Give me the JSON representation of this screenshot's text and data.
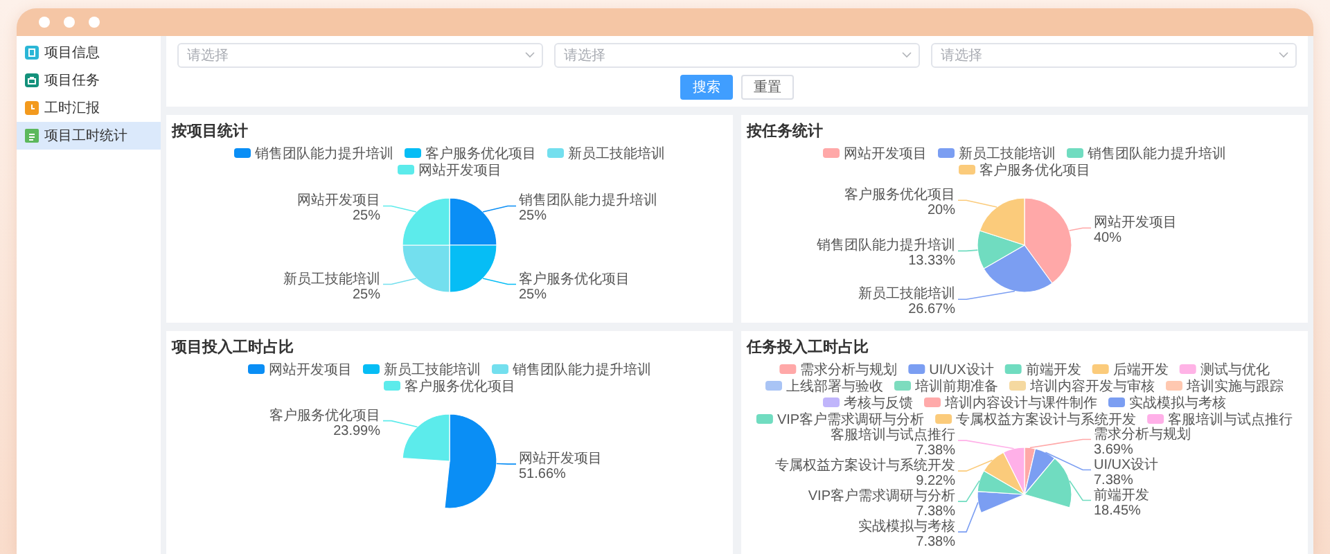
{
  "sidebar": {
    "items": [
      {
        "label": "项目信息",
        "kind": "info",
        "selected": false
      },
      {
        "label": "项目任务",
        "kind": "task",
        "selected": false
      },
      {
        "label": "工时汇报",
        "kind": "report",
        "selected": false
      },
      {
        "label": "项目工时统计",
        "kind": "stats",
        "selected": true
      }
    ]
  },
  "filters": {
    "selects": [
      {
        "placeholder": "请选择"
      },
      {
        "placeholder": "请选择"
      },
      {
        "placeholder": "请选择"
      }
    ],
    "buttons": [
      {
        "label": "搜索",
        "kind": "primary"
      },
      {
        "label": "重置",
        "kind": "default"
      }
    ]
  },
  "charts": [
    {
      "title": "按项目统计",
      "legend": [
        {
          "label": "销售团队能力提升培训",
          "color": "#0a8ef5"
        },
        {
          "label": "客户服务优化项目",
          "color": "#06bdf5"
        },
        {
          "label": "新员工技能培训",
          "color": "#73dfee"
        },
        {
          "label": "网站开发项目",
          "color": "#5cebeb"
        }
      ],
      "chart_data": {
        "type": "pie",
        "categories": [
          "销售团队能力提升培训",
          "客户服务优化项目",
          "新员工技能培训",
          "网站开发项目"
        ],
        "values": [
          25,
          25,
          25,
          25
        ],
        "value_labels": [
          "25%",
          "25%",
          "25%",
          "25%"
        ]
      }
    },
    {
      "title": "按任务统计",
      "legend": [
        {
          "label": "网站开发项目",
          "color": "#ffa8a8"
        },
        {
          "label": "新员工技能培训",
          "color": "#7b9ef2"
        },
        {
          "label": "销售团队能力提升培训",
          "color": "#70dcc0"
        },
        {
          "label": "客户服务优化项目",
          "color": "#fbcb7b"
        }
      ],
      "chart_data": {
        "type": "pie",
        "categories": [
          "网站开发项目",
          "新员工技能培训",
          "销售团队能力提升培训",
          "客户服务优化项目"
        ],
        "values": [
          40,
          26.67,
          13.33,
          20
        ],
        "value_labels": [
          "40%",
          "26.67%",
          "13.33%",
          "20%"
        ]
      }
    },
    {
      "title": "项目投入工时占比",
      "legend": [
        {
          "label": "网站开发项目",
          "color": "#0a8ef5"
        },
        {
          "label": "新员工技能培训",
          "color": "#06bdf5"
        },
        {
          "label": "销售团队能力提升培训",
          "color": "#73dfee"
        },
        {
          "label": "客户服务优化项目",
          "color": "#5cebeb"
        }
      ],
      "chart_data": {
        "type": "pie",
        "categories": [
          "网站开发项目",
          null,
          "客户服务优化项目"
        ],
        "values": [
          51.66,
          null,
          23.99
        ],
        "value_labels": [
          "51.66%",
          null,
          "23.99%"
        ]
      }
    },
    {
      "title": "任务投入工时占比",
      "legend": [
        {
          "label": "需求分析与规划",
          "color": "#ffa8a8"
        },
        {
          "label": "UI/UX设计",
          "color": "#7b9ef2"
        },
        {
          "label": "前端开发",
          "color": "#70dcc0"
        },
        {
          "label": "后端开发",
          "color": "#fbcb7b"
        },
        {
          "label": "测试与优化",
          "color": "#ffb3e6"
        },
        {
          "label": "上线部署与验收",
          "color": "#a9c4f5"
        },
        {
          "label": "培训前期准备",
          "color": "#7ddcbe"
        },
        {
          "label": "培训内容开发与审核",
          "color": "#f5d9a0"
        },
        {
          "label": "培训实施与跟踪",
          "color": "#ffc8b0"
        },
        {
          "label": "考核与反馈",
          "color": "#c0b5fb"
        },
        {
          "label": "培训内容设计与课件制作",
          "color": "#ffaaaa"
        },
        {
          "label": "实战模拟与考核",
          "color": "#7b9ef2"
        },
        {
          "label": "VIP客户需求调研与分析",
          "color": "#70dcc0"
        },
        {
          "label": "专属权益方案设计与系统开发",
          "color": "#fbcb7b"
        },
        {
          "label": "客服培训与试点推行",
          "color": "#ffb0e8"
        }
      ],
      "chart_data": {
        "type": "pie",
        "categories": [
          "需求分析与规划",
          "UI/UX设计",
          "前端开发",
          null,
          "实战模拟与考核",
          "VIP客户需求调研与分析",
          "专属权益方案设计与系统开发",
          "客服培训与试点推行"
        ],
        "values": [
          3.69,
          7.38,
          18.45,
          null,
          7.38,
          7.38,
          9.22,
          7.38
        ],
        "value_labels": [
          "3.69%",
          "7.38%",
          "18.45%",
          null,
          "7.38%",
          "7.38%",
          "9.22%",
          "7.38%"
        ]
      }
    }
  ]
}
